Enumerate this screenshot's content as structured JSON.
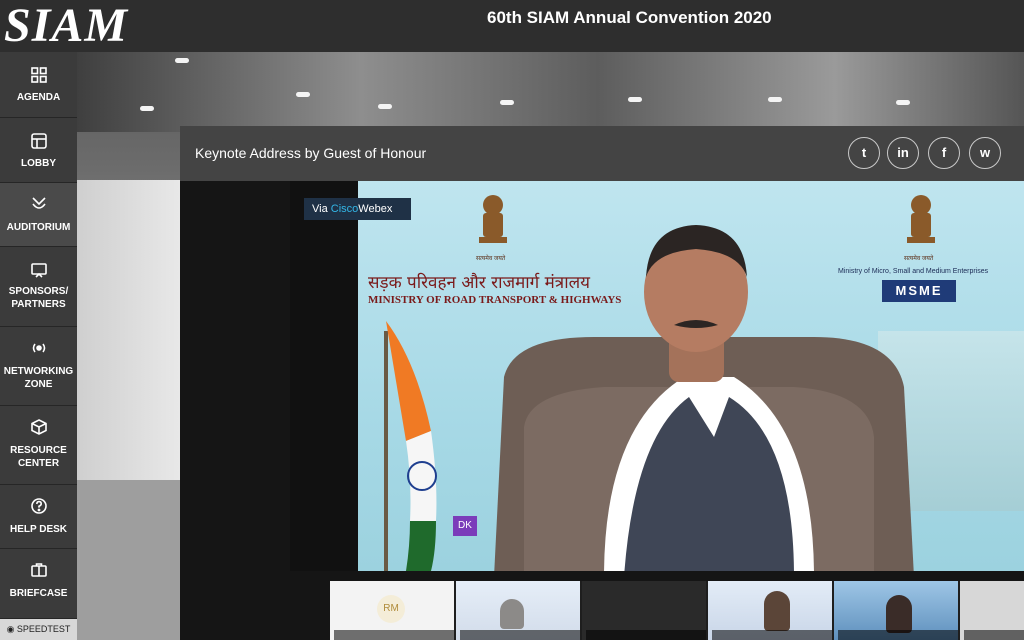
{
  "header": {
    "logo": "SIAM",
    "event_title": "60th SIAM Annual Convention 2020"
  },
  "sidebar": {
    "items": [
      {
        "label": "AGENDA",
        "icon": "grid-icon"
      },
      {
        "label": "LOBBY",
        "icon": "layout-icon"
      },
      {
        "label": "AUDITORIUM",
        "icon": "auditorium-icon"
      },
      {
        "label": "SPONSORS/ PARTNERS",
        "icon": "monitor-icon"
      },
      {
        "label": "NETWORKING ZONE",
        "icon": "broadcast-icon"
      },
      {
        "label": "RESOURCE CENTER",
        "icon": "cube-icon"
      },
      {
        "label": "HELP DESK",
        "icon": "question-icon"
      },
      {
        "label": "BRIEFCASE",
        "icon": "briefcase-icon"
      }
    ],
    "speedtest": "SPEEDTEST"
  },
  "panel": {
    "title": "Keynote Address by Guest of Honour",
    "share_buttons": [
      {
        "name": "twitter",
        "glyph": "t"
      },
      {
        "name": "linkedin",
        "glyph": "in"
      },
      {
        "name": "facebook",
        "glyph": "f"
      },
      {
        "name": "whatsapp",
        "glyph": "w"
      }
    ]
  },
  "video": {
    "via_prefix": "Via ",
    "via_brand": "Cisco",
    "via_product": "Webex",
    "hindi_ministry": "सड़क परिवहन और राजमार्ग मंत्रालय",
    "ministry_name": "MINISTRY OF ROAD TRANSPORT & HIGHWAYS",
    "emblem_caption": "सत्यमेव जयते",
    "msme_caption": "Ministry of Micro, Small and Medium Enterprises",
    "msme_logo": "MSME"
  },
  "thumbnails": {
    "initials": "RM"
  },
  "colors": {
    "topbar": "#2e2e2e",
    "sidebar": "#3b3b3b",
    "panel_header": "#444444",
    "via_badge": "#1f3146",
    "cisco_accent": "#33b6e6"
  }
}
